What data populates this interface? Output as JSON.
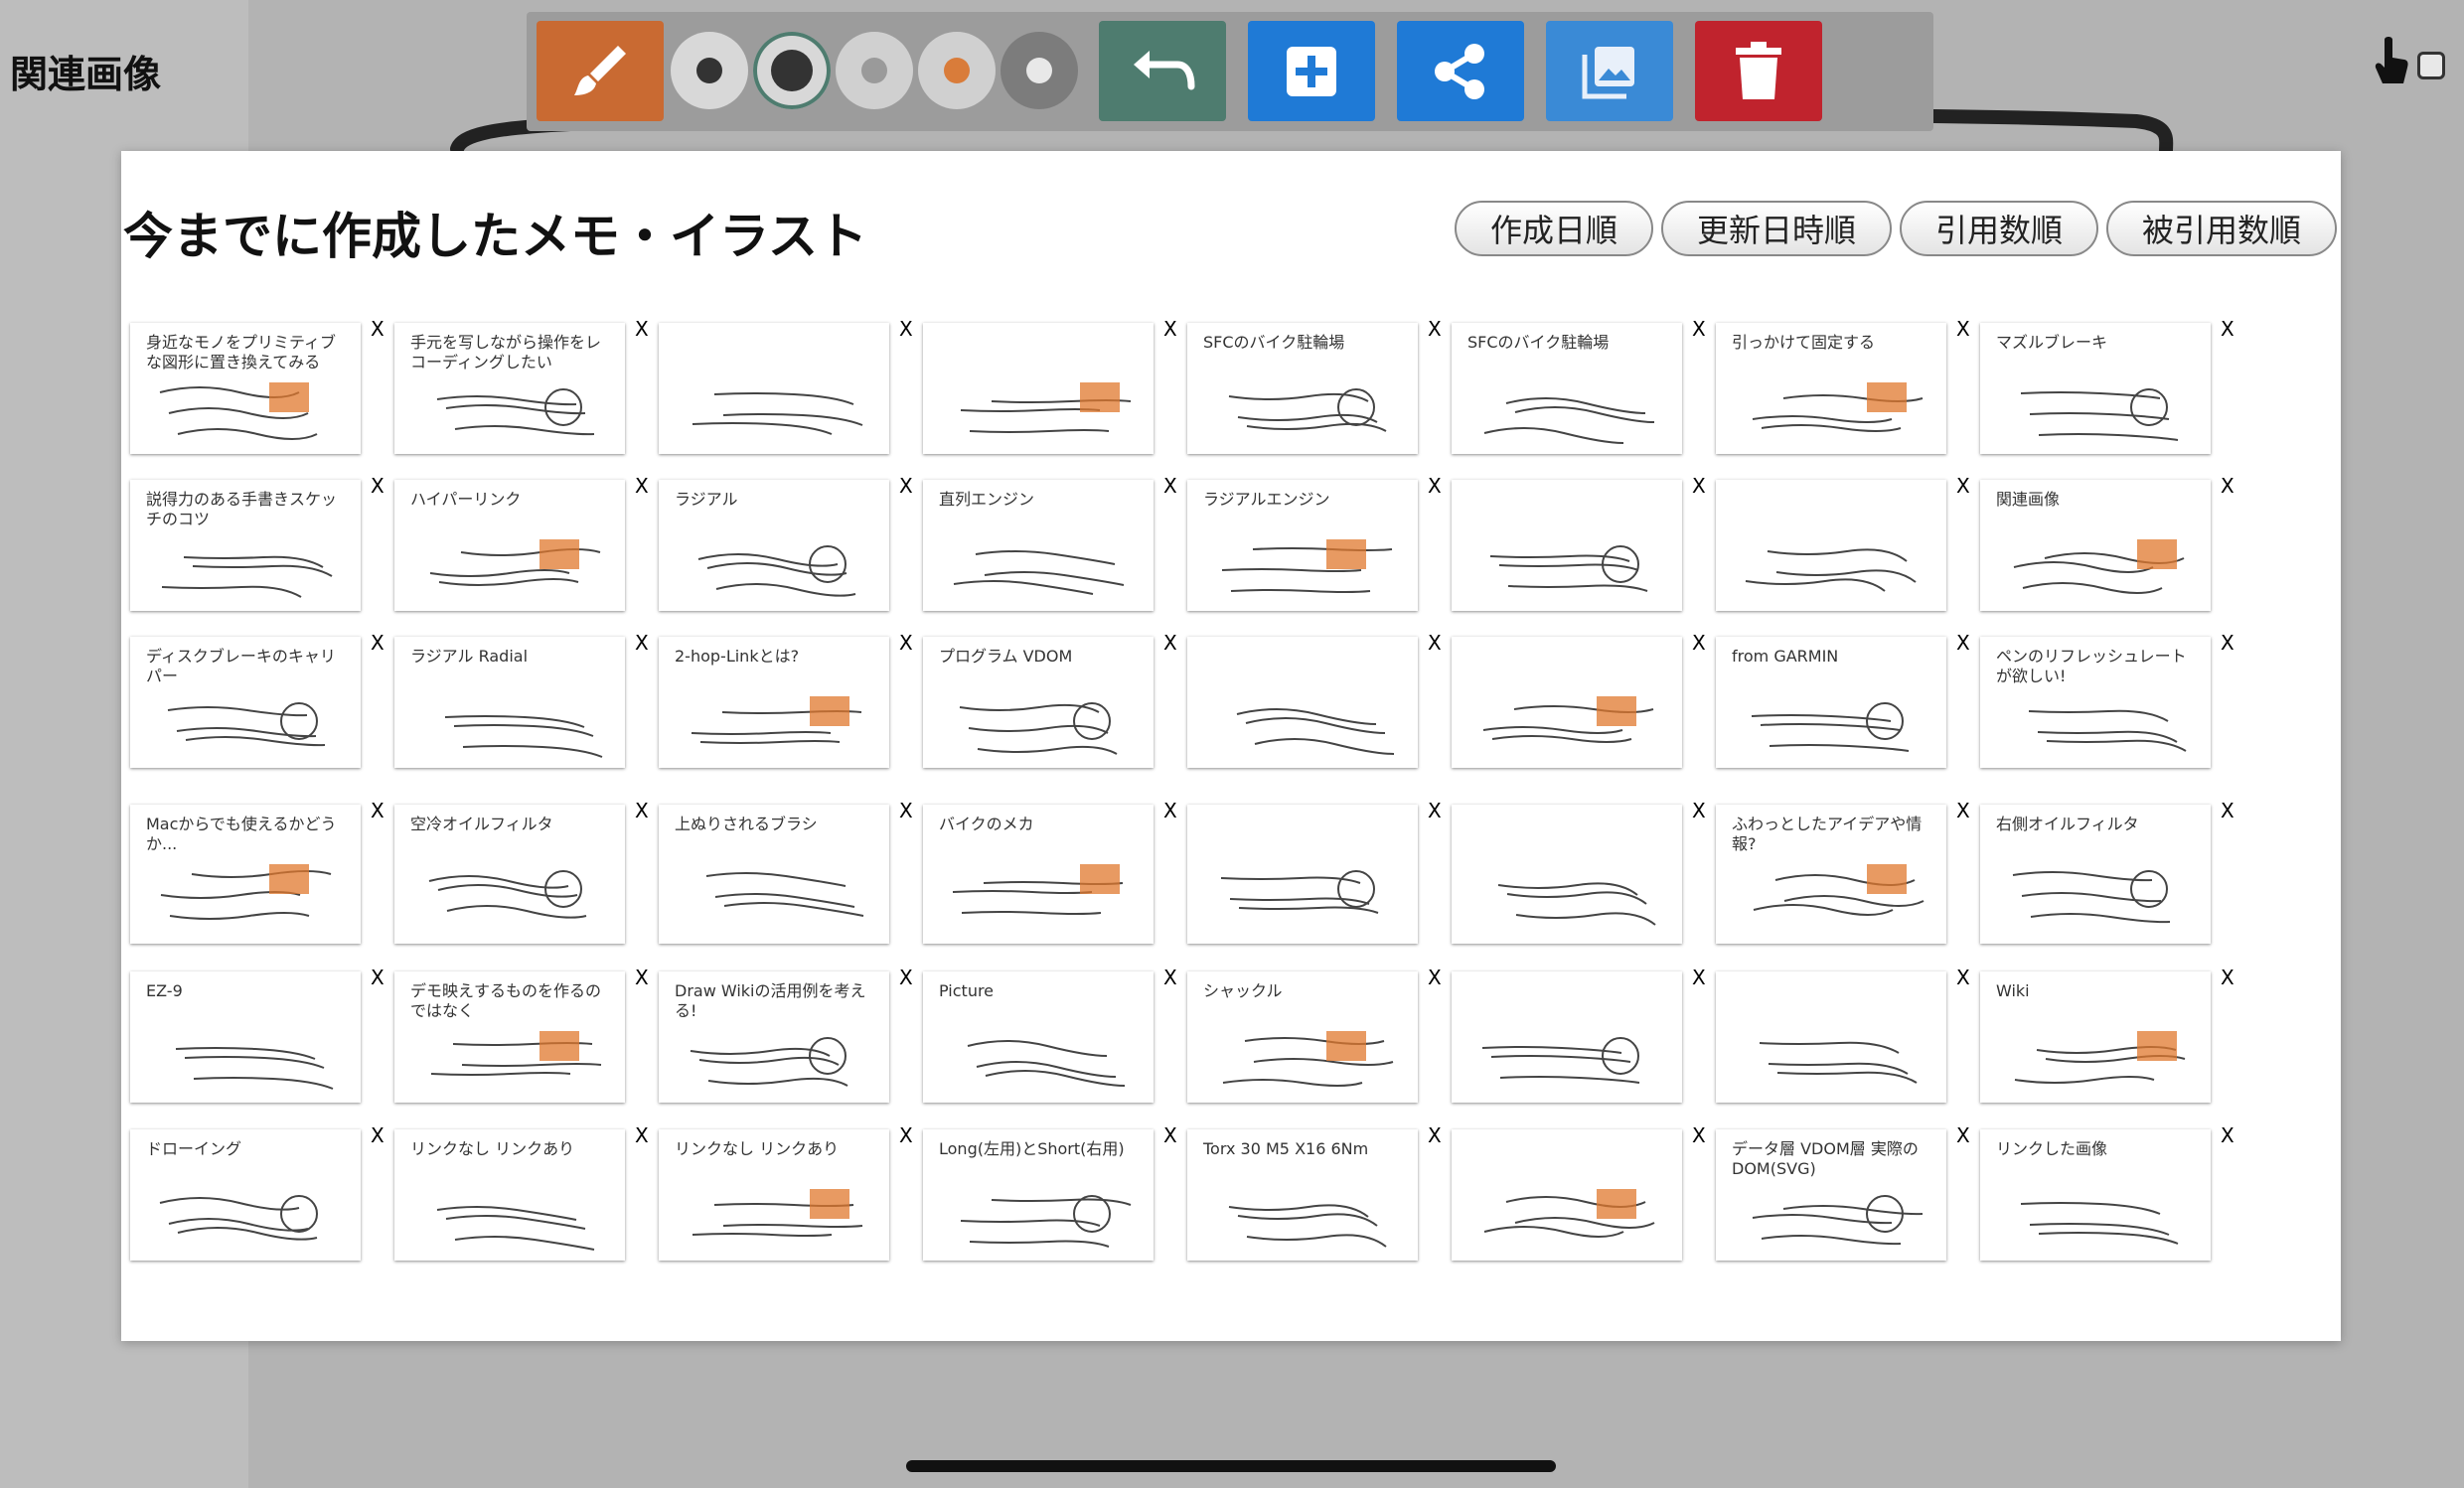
{
  "sidebar": {
    "title": "関連画像"
  },
  "toolbar": {
    "pen_icon": "brush-icon",
    "sizes": [
      "small",
      "large",
      "medium",
      "medium-orange",
      "medium-grey"
    ],
    "colors": {
      "pen": "#c96a32",
      "undo": "#4e7c6f",
      "blue": "#1f7ad6",
      "trash": "#c0232d"
    }
  },
  "panel": {
    "title": "今までに作成したメモ・イラスト",
    "sort_buttons": [
      "作成日順",
      "更新日時順",
      "引用数順",
      "被引用数順"
    ],
    "delete_label": "X"
  },
  "thumbnails": [
    [
      "身近なモノをプリミティブな図形に置き換えてみる",
      "手元を写しながら操作をレコーディングしたい",
      "",
      "",
      "SFCのバイク駐輪場",
      "SFCのバイク駐輪場",
      "引っかけて固定する",
      "マズルブレーキ"
    ],
    [
      "説得力のある手書きスケッチのコツ",
      "ハイパーリンク",
      "ラジアル",
      "直列エンジン",
      "ラジアルエンジン",
      "",
      "",
      "関連画像"
    ],
    [
      "ディスクブレーキのキャリパー",
      "ラジアル Radial",
      "2-hop-Linkとは?",
      "プログラム VDOM",
      "",
      "",
      "from GARMIN",
      "ペンのリフレッシュレートが欲しい!"
    ],
    [
      "Macからでも使えるかどうか...",
      "空冷オイルフィルタ",
      "上ぬりされるブラシ",
      "バイクのメカ",
      "",
      "",
      "ふわっとしたアイデアや情報?",
      "右側オイルフィルタ"
    ],
    [
      "EZ-9",
      "デモ映えするものを作るのではなく",
      "Draw Wikiの活用例を考える!",
      "Picture",
      "シャックル",
      "",
      "",
      "Wiki"
    ],
    [
      "ドローイング",
      "リンクなし リンクあり",
      "リンクなし リンクあり",
      "Long(左用)とShort(右用)",
      "Torx 30 M5 X16 6Nm",
      "",
      "データ層 VDOM層 実際のDOM(SVG)",
      "リンクした画像"
    ]
  ]
}
